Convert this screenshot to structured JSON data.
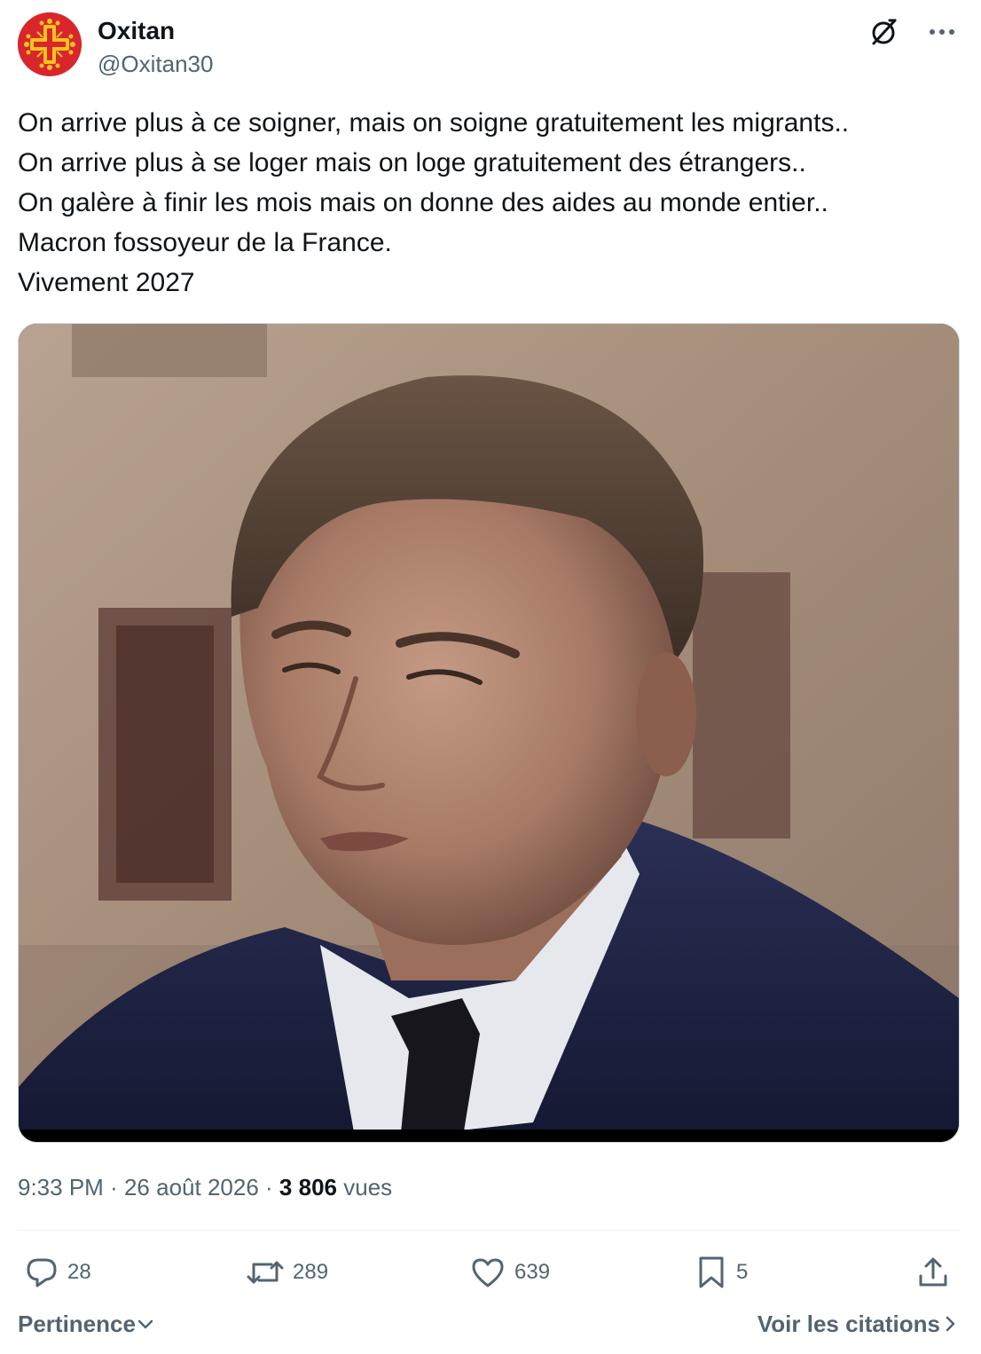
{
  "author": {
    "name": "Oxitan",
    "handle": "@Oxitan30",
    "avatar_icon": "occitan-cross-icon",
    "avatar_color": "#d8262c"
  },
  "tweet": {
    "lines": [
      "On arrive plus à ce soigner, mais on soigne gratuitement les migrants..",
      "On arrive plus à se loger mais on loge gratuitement des étrangers..",
      "On galère à finir les mois mais on donne des aides au monde entier..",
      "Macron fossoyeur de la France.",
      "Vivement 2027"
    ]
  },
  "meta": {
    "time": "9:33 PM",
    "date": "26 août 2026",
    "separator": "·",
    "views_count": "3 806",
    "views_label": "vues"
  },
  "actions": {
    "replies": "28",
    "reposts": "289",
    "likes": "639",
    "bookmarks": "5"
  },
  "footer": {
    "sort_label": "Pertinence",
    "quotes_label": "Voir les citations"
  },
  "colors": {
    "text_primary": "#0f1419",
    "text_secondary": "#536471",
    "divider": "#eff3f4"
  }
}
